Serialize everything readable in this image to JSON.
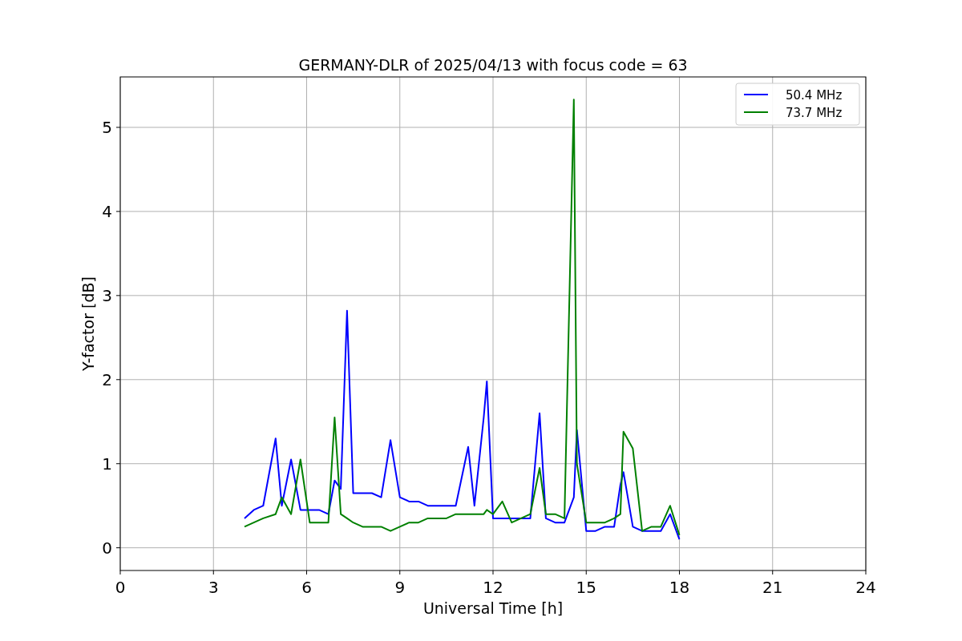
{
  "figure": {
    "chart_data": {
      "type": "line",
      "title": "GERMANY-DLR of 2025/04/13 with focus code = 63",
      "xlabel": "Universal Time [h]",
      "ylabel": "Y-factor [dB]",
      "x": [
        4.0,
        4.3,
        4.6,
        5.0,
        5.2,
        5.5,
        5.8,
        6.1,
        6.4,
        6.7,
        6.9,
        7.1,
        7.3,
        7.5,
        7.8,
        8.1,
        8.4,
        8.7,
        9.0,
        9.3,
        9.6,
        9.9,
        10.2,
        10.5,
        10.8,
        11.2,
        11.4,
        11.7,
        11.8,
        12.0,
        12.3,
        12.6,
        12.9,
        13.2,
        13.5,
        13.7,
        14.0,
        14.3,
        14.6,
        14.7,
        15.0,
        15.3,
        15.6,
        15.9,
        16.1,
        16.2,
        16.5,
        16.8,
        17.1,
        17.4,
        17.7,
        18.0
      ],
      "series": [
        {
          "name": "50.4 MHz",
          "color": "#0000ff",
          "values": [
            0.35,
            0.45,
            0.5,
            1.3,
            0.5,
            1.05,
            0.45,
            0.45,
            0.45,
            0.4,
            0.8,
            0.7,
            2.82,
            0.65,
            0.65,
            0.65,
            0.6,
            1.28,
            0.6,
            0.55,
            0.55,
            0.5,
            0.5,
            0.5,
            0.5,
            1.2,
            0.5,
            1.55,
            1.98,
            0.35,
            0.35,
            0.35,
            0.35,
            0.35,
            1.6,
            0.35,
            0.3,
            0.3,
            0.6,
            1.4,
            0.2,
            0.2,
            0.25,
            0.25,
            0.75,
            0.9,
            0.25,
            0.2,
            0.2,
            0.2,
            0.4,
            0.1
          ]
        },
        {
          "name": "73.7 MHz",
          "color": "#008000",
          "values": [
            0.25,
            0.3,
            0.35,
            0.4,
            0.6,
            0.4,
            1.05,
            0.3,
            0.3,
            0.3,
            1.55,
            0.4,
            0.35,
            0.3,
            0.25,
            0.25,
            0.25,
            0.2,
            0.25,
            0.3,
            0.3,
            0.35,
            0.35,
            0.35,
            0.4,
            0.4,
            0.4,
            0.4,
            0.45,
            0.4,
            0.55,
            0.3,
            0.35,
            0.4,
            0.95,
            0.4,
            0.4,
            0.35,
            5.33,
            1.0,
            0.3,
            0.3,
            0.3,
            0.35,
            0.4,
            1.38,
            1.18,
            0.2,
            0.25,
            0.25,
            0.5,
            0.15
          ]
        }
      ],
      "xlim": [
        0,
        24
      ],
      "ylim": [
        -0.27,
        5.6
      ],
      "xticks": [
        0,
        3,
        6,
        9,
        12,
        15,
        18,
        21,
        24
      ],
      "yticks": [
        0,
        1,
        2,
        3,
        4,
        5
      ],
      "grid": true,
      "legend": true
    }
  }
}
